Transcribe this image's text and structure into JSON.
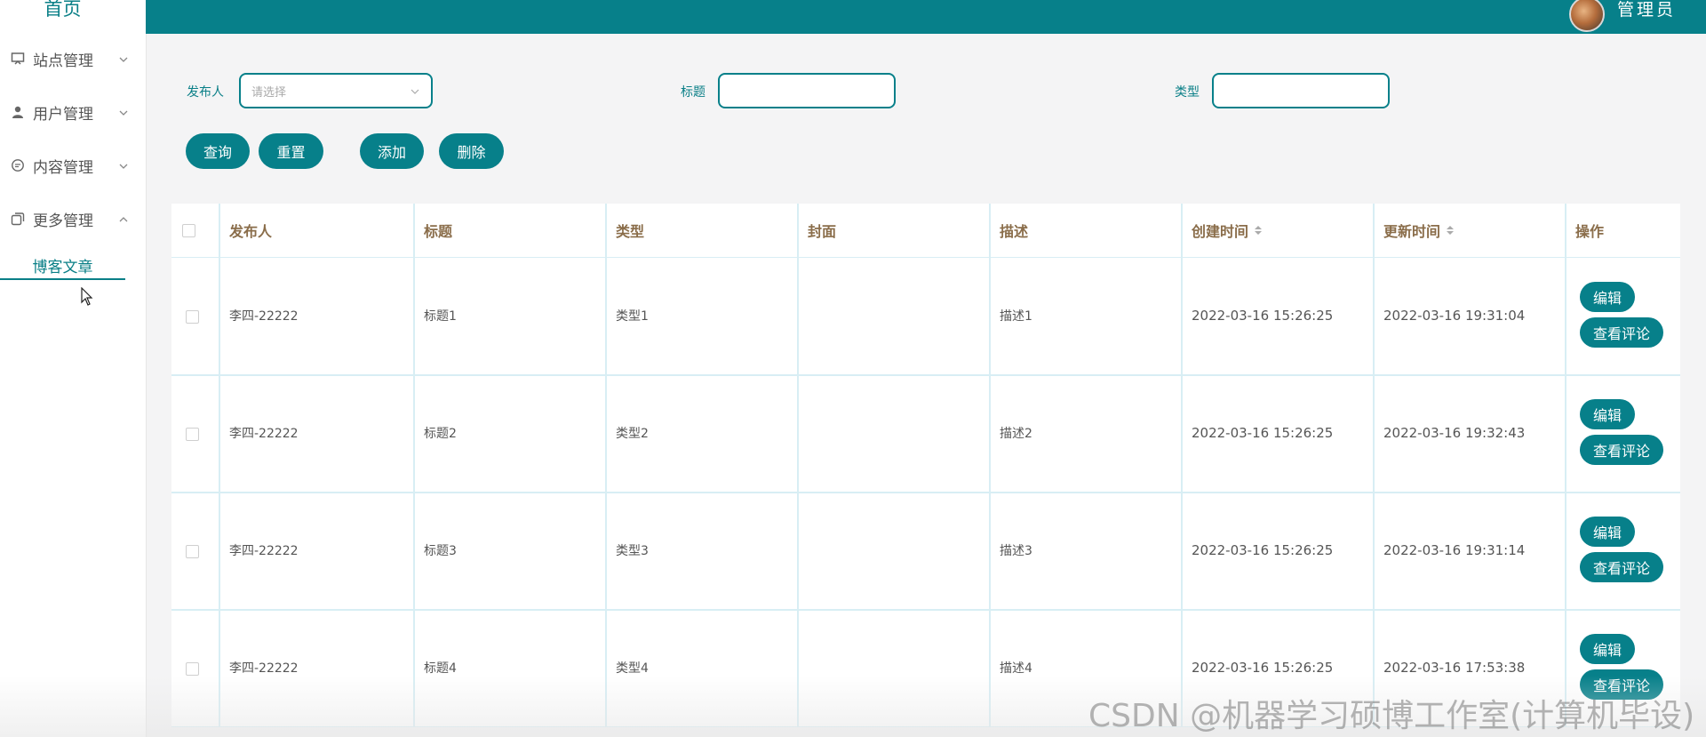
{
  "sidebar": {
    "home": "首页",
    "items": [
      {
        "label": "站点管理",
        "icon": "monitor-icon",
        "chevron": "chevron-down-icon"
      },
      {
        "label": "用户管理",
        "icon": "user-icon",
        "chevron": "chevron-down-icon"
      },
      {
        "label": "内容管理",
        "icon": "chat-icon",
        "chevron": "chevron-down-icon"
      },
      {
        "label": "更多管理",
        "icon": "copy-icon",
        "chevron": "chevron-up-icon"
      }
    ],
    "active_sub": "博客文章"
  },
  "header": {
    "user_name": "管理员"
  },
  "search": {
    "publisher_label": "发布人",
    "publisher_placeholder": "请选择",
    "title_label": "标题",
    "type_label": "类型",
    "query_button": "查询",
    "reset_button": "重置",
    "add_button": "添加",
    "delete_button": "删除"
  },
  "table": {
    "columns": [
      "发布人",
      "标题",
      "类型",
      "封面",
      "描述",
      "创建时间",
      "更新时间",
      "操作"
    ],
    "rows": [
      {
        "publisher": "李四-22222",
        "title": "标题1",
        "type": "类型1",
        "cover": "",
        "desc": "描述1",
        "created": "2022-03-16 15:26:25",
        "updated": "2022-03-16 19:31:04"
      },
      {
        "publisher": "李四-22222",
        "title": "标题2",
        "type": "类型2",
        "cover": "",
        "desc": "描述2",
        "created": "2022-03-16 15:26:25",
        "updated": "2022-03-16 19:32:43"
      },
      {
        "publisher": "李四-22222",
        "title": "标题3",
        "type": "类型3",
        "cover": "",
        "desc": "描述3",
        "created": "2022-03-16 15:26:25",
        "updated": "2022-03-16 19:31:14"
      },
      {
        "publisher": "李四-22222",
        "title": "标题4",
        "type": "类型4",
        "cover": "",
        "desc": "描述4",
        "created": "2022-03-16 15:26:25",
        "updated": "2022-03-16 17:53:38"
      }
    ],
    "edit_label": "编辑",
    "comments_label": "查看评论"
  },
  "watermark": "CSDN @机器学习硕博工作室(计算机毕设)",
  "colors": {
    "accent": "#07808a",
    "header_text": "#8a6d4a",
    "grid_line": "#d8eef4"
  }
}
